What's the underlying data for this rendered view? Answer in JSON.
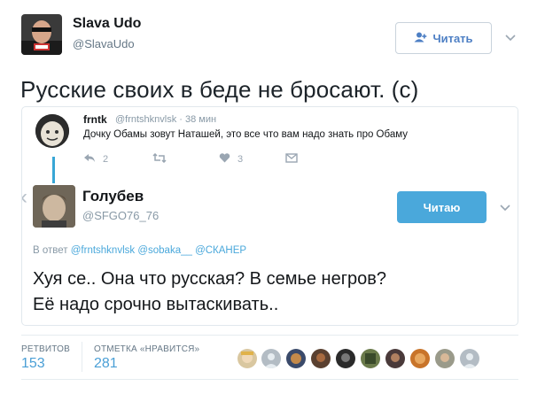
{
  "author": {
    "name": "Slava Udo",
    "handle": "@SlavaUdo"
  },
  "follow_button": {
    "label": "Читать"
  },
  "tweet": {
    "text": "Русские своих в беде не бросают. (с)"
  },
  "quoted": {
    "first": {
      "name": "frntk",
      "handle_time": "@frntshknvlsk · 38 мин",
      "text": "Дочку Обамы зовут Наташей, это все что вам надо знать про Обаму",
      "replies": "2",
      "likes": "3"
    },
    "second": {
      "name": "Голубев",
      "handle": "@SFGO76_76",
      "button_label": "Читаю",
      "reply_prefix": "В ответ",
      "reply_to": "@frntshknvlsk @sobaka__ @СКАНЕР",
      "text_line1": "Хуя се.. Она что русская? В семье негров?",
      "text_line2": "Её надо срочно вытаскивать.."
    }
  },
  "stats": {
    "retweets_label": "РЕТВИТОВ",
    "retweets_value": "153",
    "likes_label": "ОТМЕТКА «НРАВИТСЯ»",
    "likes_value": "281"
  },
  "colors": {
    "link": "#4a9fd6",
    "follow_button_bg": "#4aa8db",
    "thread_line": "#38a6d6"
  },
  "icons": [
    "person-plus-icon",
    "chevron-down-icon",
    "reply-icon",
    "retweet-icon",
    "heart-icon",
    "dm-icon"
  ]
}
